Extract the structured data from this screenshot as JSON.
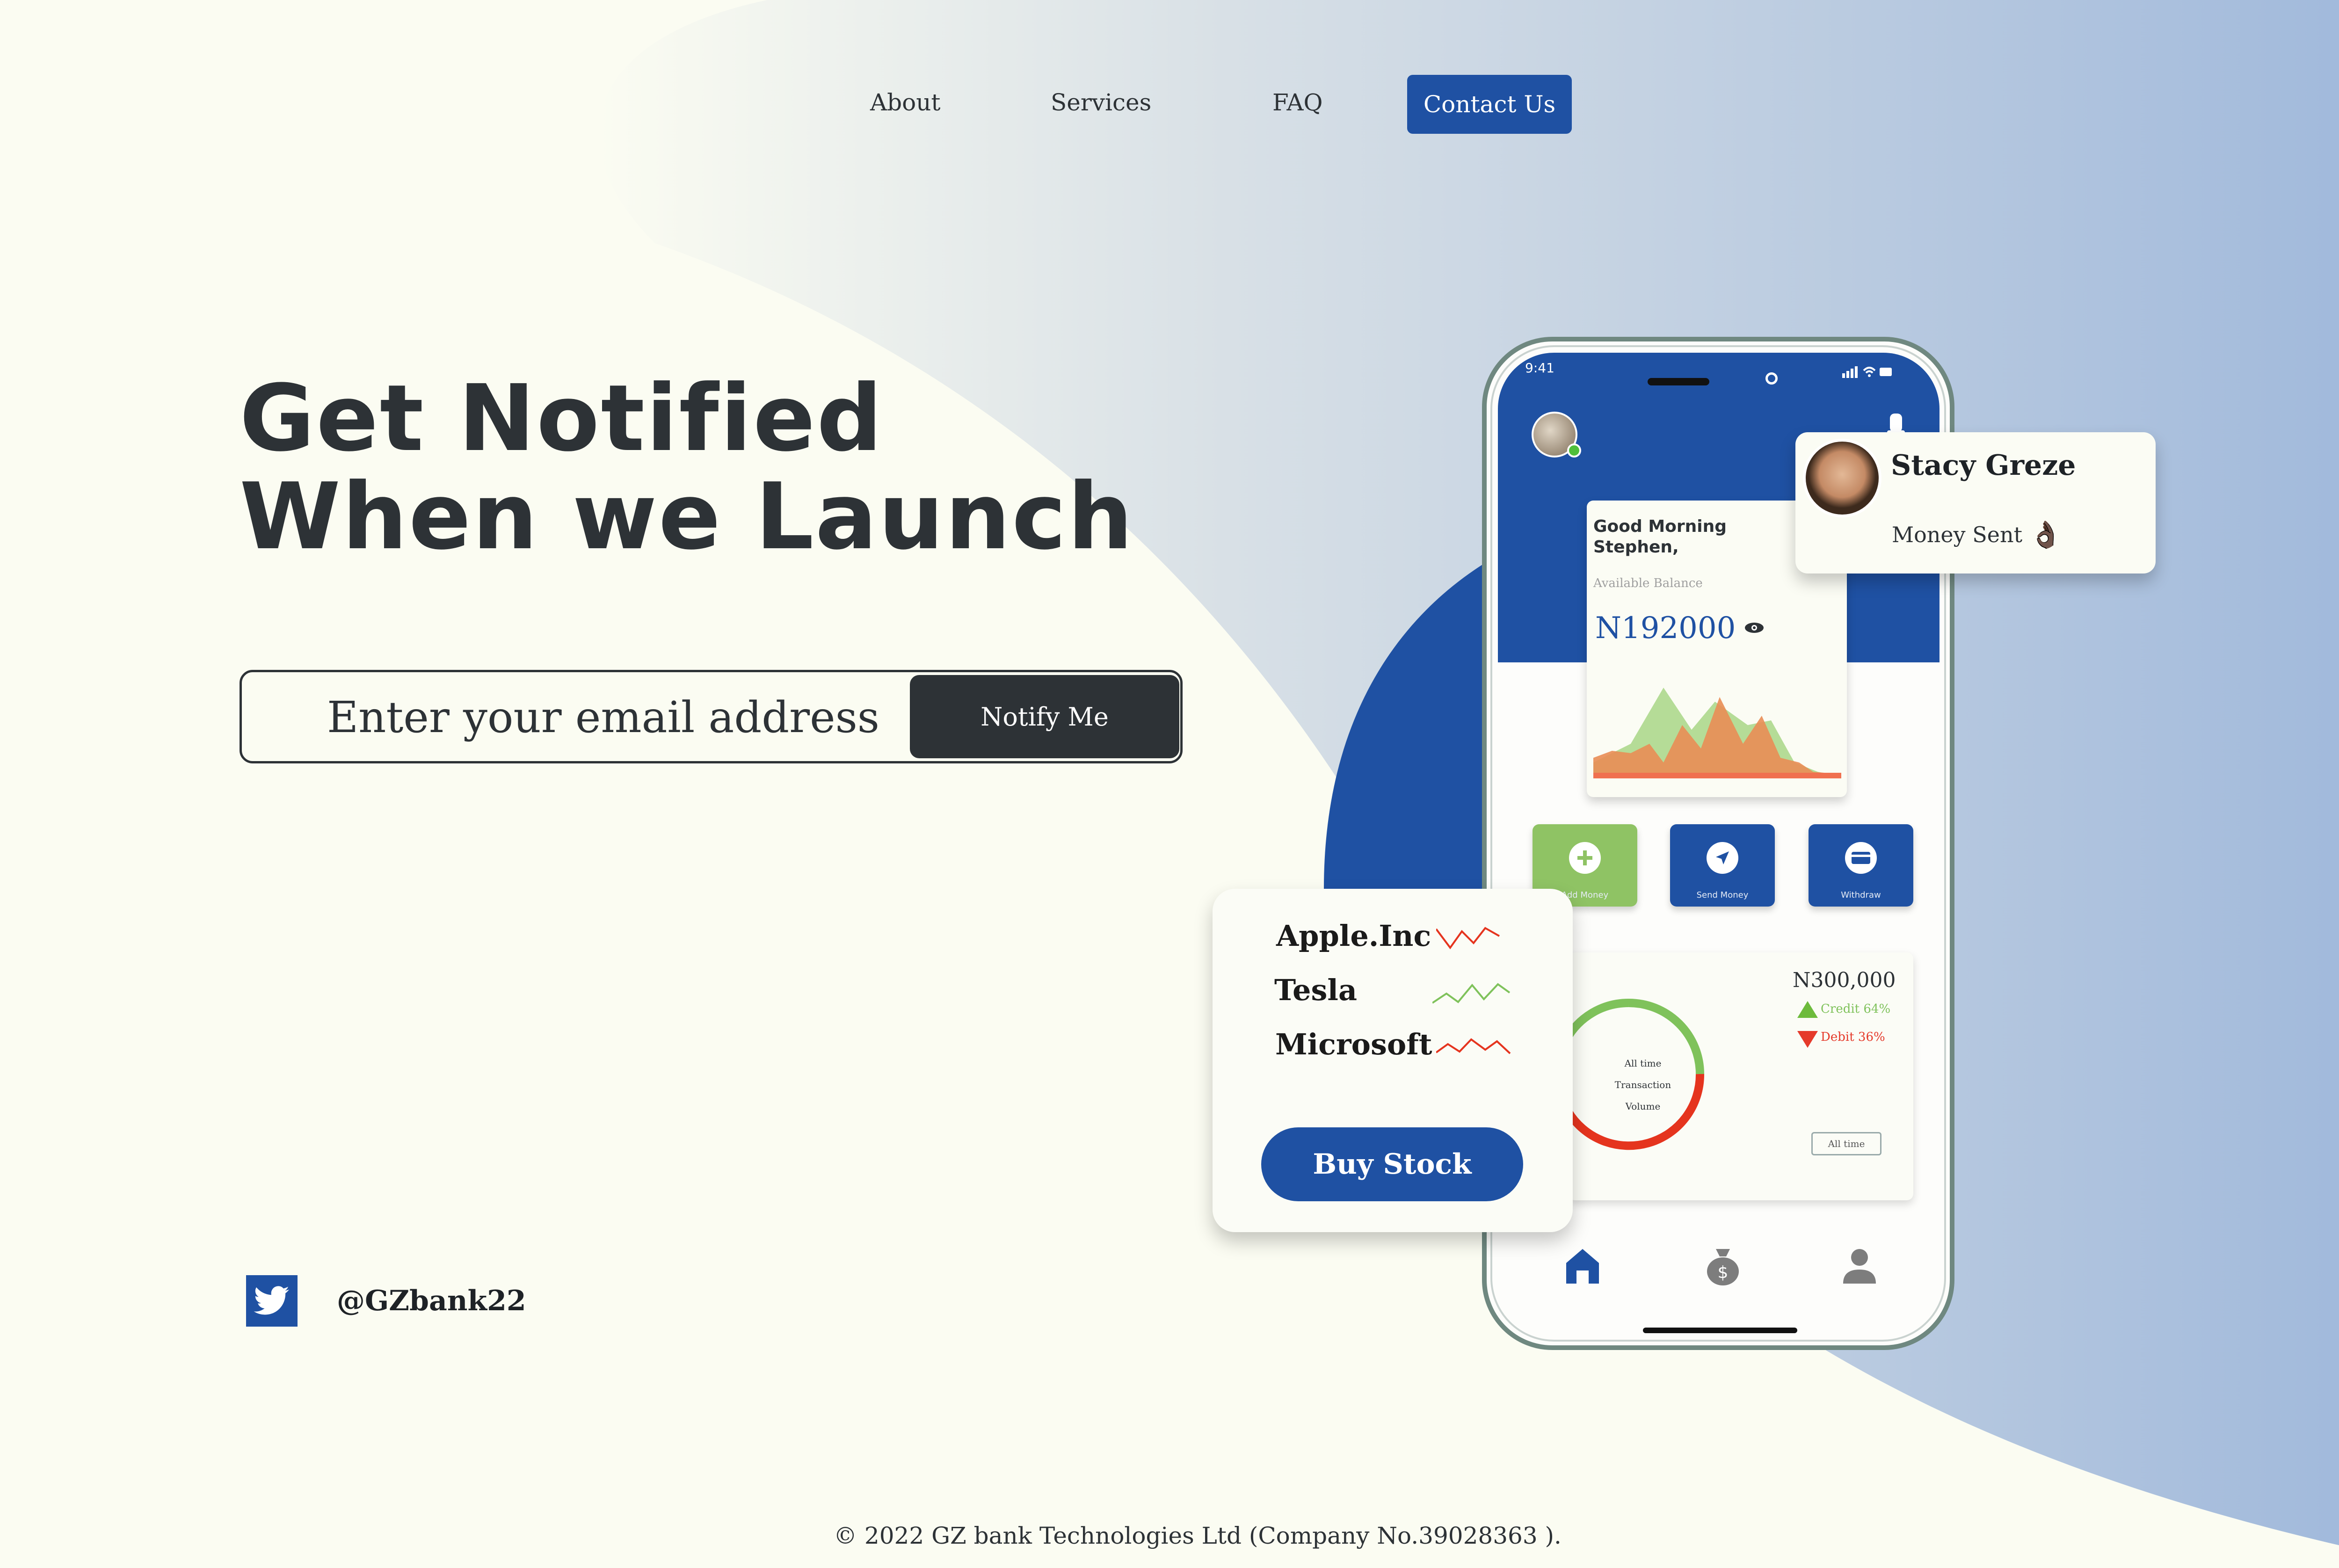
{
  "nav": {
    "items": [
      {
        "label": "About"
      },
      {
        "label": "Services"
      },
      {
        "label": "FAQ"
      }
    ],
    "contact_label": "Contact Us"
  },
  "hero": {
    "title_line1": "Get Notified",
    "title_line2": "When we Launch"
  },
  "signup": {
    "placeholder": "Enter your email address",
    "button_label": "Notify Me"
  },
  "social": {
    "icon": "twitter-icon",
    "handle": "@GZbank22"
  },
  "footer": {
    "copyright": "© 2022 GZ bank Technologies Ltd (Company No.39028363 )."
  },
  "phone": {
    "status_time": "9:41",
    "greeting": "Good Morning Stephen,",
    "balance_label": "Available Balance",
    "balance": "N192000",
    "actions": [
      {
        "label": "Add Money",
        "icon": "plus-icon",
        "color": "#8fc364"
      },
      {
        "label": "Send Money",
        "icon": "send-icon",
        "color": "#1f51a3"
      },
      {
        "label": "Withdraw",
        "icon": "card-icon",
        "color": "#1f51a3"
      }
    ],
    "transactions": {
      "amount": "N300,000",
      "credit": "Credit 64%",
      "debit": "Debit 36%",
      "donut_label": [
        "All time",
        "Transaction",
        "Volume"
      ],
      "filter": "All time"
    },
    "tabs": [
      "home-icon",
      "money-bag-icon",
      "profile-icon"
    ]
  },
  "notification": {
    "name": "Stacy Greze",
    "message": "Money Sent",
    "emoji": "👌🏿"
  },
  "stocks": {
    "items": [
      {
        "name": "Apple.Inc",
        "trend": "down"
      },
      {
        "name": "Tesla",
        "trend": "up"
      },
      {
        "name": "Microsoft",
        "trend": "down"
      }
    ],
    "button_label": "Buy Stock"
  },
  "colors": {
    "brand_blue": "#1f51a3",
    "dark": "#2d3236",
    "background": "#fbfcf2",
    "green": "#8fc364",
    "red": "#e53a2b"
  }
}
